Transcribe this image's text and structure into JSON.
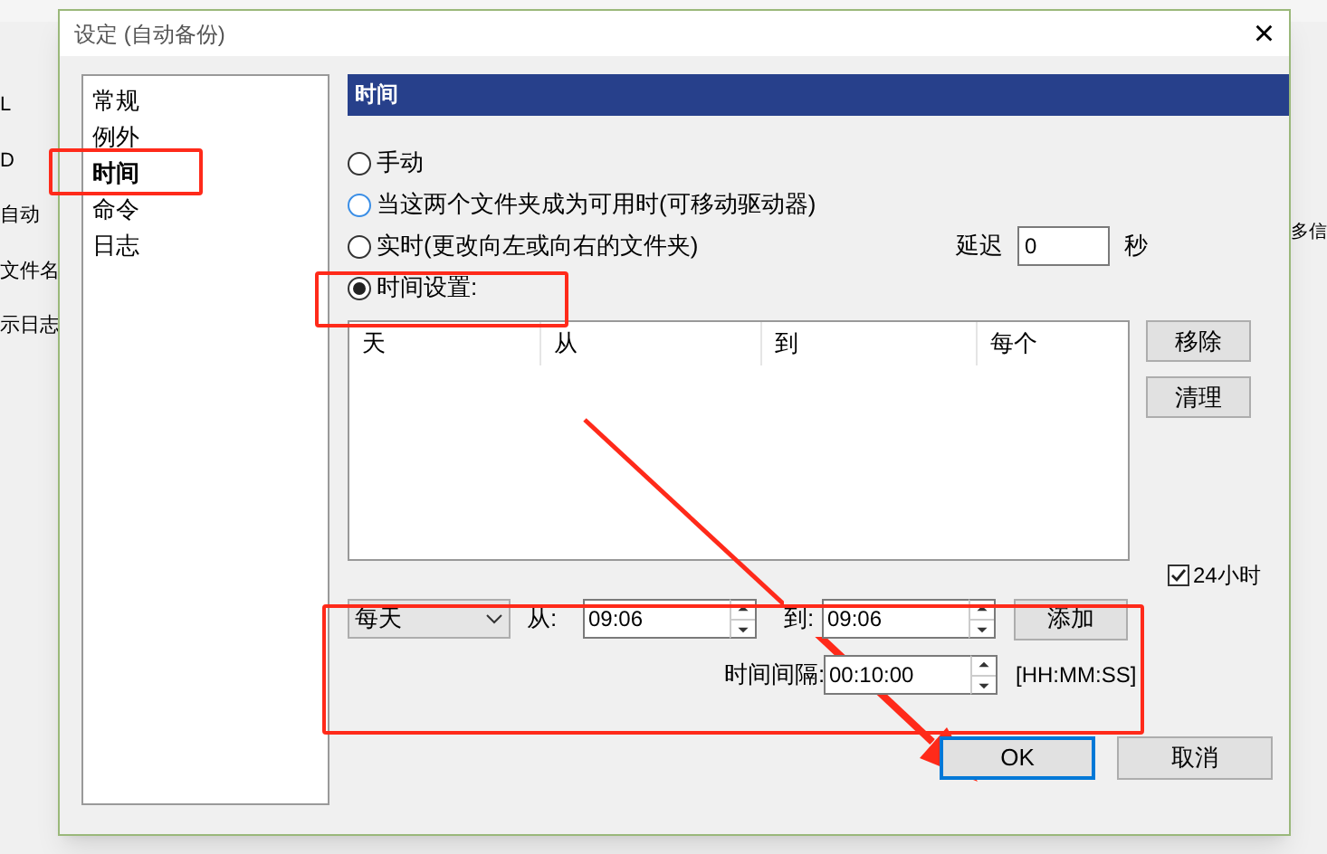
{
  "background_app": {
    "left_fragments": [
      "L",
      "D",
      "自动",
      "文件名",
      "示日志"
    ],
    "right_fragment": "多信"
  },
  "dialog": {
    "title": "设定 (自动备份)",
    "close": "×",
    "sidebar": [
      {
        "label": "常规",
        "selected": false
      },
      {
        "label": "例外",
        "selected": false
      },
      {
        "label": "时间",
        "selected": true
      },
      {
        "label": "命令",
        "selected": false
      },
      {
        "label": "日志",
        "selected": false
      }
    ],
    "section_header": "时间",
    "modes": [
      {
        "label": "手动",
        "selected": false
      },
      {
        "label": "当这两个文件夹成为可用时(可移动驱动器)",
        "selected": false
      },
      {
        "label": "实时(更改向左或向右的文件夹)",
        "selected": false
      },
      {
        "label": "时间设置:",
        "selected": true
      }
    ],
    "delay": {
      "label": "延迟",
      "value": "0",
      "unit": "秒"
    },
    "schedule_table": {
      "columns": [
        "天",
        "从",
        "到",
        "每个"
      ]
    },
    "side_buttons": [
      "移除",
      "清理"
    ],
    "clock_24h": {
      "label": "24小时",
      "checked": true
    },
    "frequency": "每天",
    "from_label": "从:",
    "from_value": "09:06",
    "to_label": "到:",
    "to_value": "09:06",
    "add_button": "添加",
    "interval_label": "时间间隔:",
    "interval_value": "00:10:00",
    "interval_format": "[HH:MM:SS]",
    "buttons": [
      {
        "label": "OK",
        "default": true
      },
      {
        "label": "取消",
        "default": false
      }
    ]
  }
}
